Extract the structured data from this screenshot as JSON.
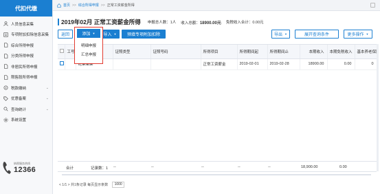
{
  "sidebar": {
    "logo": "代扣代缴",
    "items": [
      {
        "label": "人员信息采集",
        "icon": "person-icon",
        "expandable": false
      },
      {
        "label": "专项附加扣除信息采集",
        "icon": "list-icon",
        "expandable": true
      },
      {
        "label": "综合所得申报",
        "icon": "document-icon",
        "expandable": false
      },
      {
        "label": "分类所得申报",
        "icon": "document-icon",
        "expandable": false
      },
      {
        "label": "非居民所得申报",
        "icon": "document-icon",
        "expandable": false
      },
      {
        "label": "限售股所得申报",
        "icon": "document-icon",
        "expandable": false
      },
      {
        "label": "税款缴纳",
        "icon": "coin-icon",
        "expandable": true
      },
      {
        "label": "优惠备案",
        "icon": "tag-icon",
        "expandable": true
      },
      {
        "label": "查询统计",
        "icon": "search-icon",
        "expandable": true
      },
      {
        "label": "系统设置",
        "icon": "gear-icon",
        "expandable": false
      }
    ],
    "hotline_label": "纳税服务热线",
    "hotline_number": "12366"
  },
  "breadcrumb": {
    "home": "首页",
    "level1": "综合所得申报",
    "level2": "正常工资薪金所得"
  },
  "header": {
    "title": "2019年02月 正常工资薪金所得",
    "stat_people": "申报总人数：1人",
    "stat_income_label": "收入总额：",
    "stat_income_value": "18900.00元",
    "stat_exempt": "免税收入合计：0.00元"
  },
  "toolbar": {
    "back": "返回",
    "add": "添加",
    "import": "导入",
    "prefill": "预填专项附加扣除",
    "export": "导出",
    "expand_search": "展开查询条件",
    "more": "更多操作"
  },
  "dropdown": {
    "head": "添加",
    "items": [
      "明细申报",
      "汇总申报"
    ]
  },
  "table": {
    "columns": [
      "",
      "工号",
      "姓名",
      "证照类型",
      "证照号码",
      "所得项目",
      "所得期间起",
      "所得期间止",
      "本期收入",
      "本期免税收入",
      "基本养老保险"
    ],
    "rows": [
      [
        "",
        "",
        "花朵朵朵",
        "",
        "",
        "正常工资薪金",
        "2019-02-01",
        "2019-02-28",
        "18900.00",
        "0.00",
        "0"
      ]
    ]
  },
  "footer": {
    "total_label": "合计",
    "record_count": "记录数：1",
    "dash1": "--",
    "dash2": "--",
    "dash3": "--",
    "dash4": "--",
    "dash5": "--",
    "income_total": "18,900.00",
    "exempt_total": "0.00"
  },
  "pager": {
    "summary": "< 1/1 >  共1条记录  每页显示条数",
    "page_size": "1000"
  }
}
